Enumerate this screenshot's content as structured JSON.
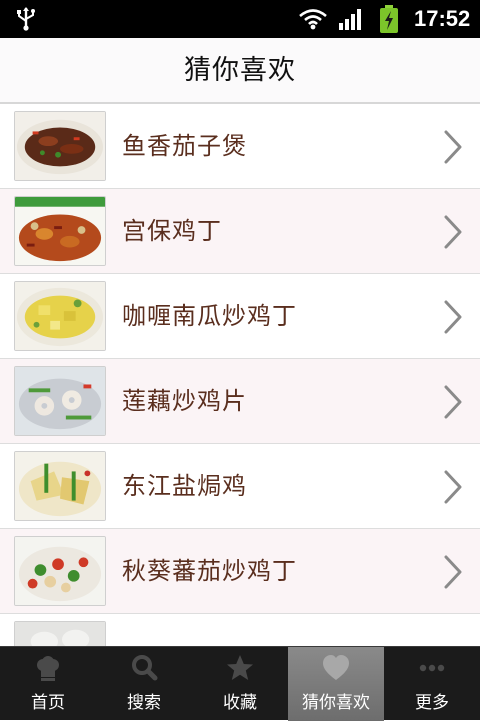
{
  "status_bar": {
    "time": "17:52",
    "icons": [
      "usb-icon",
      "wifi-icon",
      "signal-icon",
      "battery-charging-icon"
    ]
  },
  "header": {
    "title": "猜你喜欢"
  },
  "dishes": [
    {
      "name": "鱼香茄子煲"
    },
    {
      "name": "宫保鸡丁"
    },
    {
      "name": "咖喱南瓜炒鸡丁"
    },
    {
      "name": "莲藕炒鸡片"
    },
    {
      "name": "东江盐焗鸡"
    },
    {
      "name": "秋葵蕃茄炒鸡丁"
    },
    {
      "name": ""
    }
  ],
  "tabs": [
    {
      "label": "首页",
      "icon": "chef-hat-icon",
      "active": false
    },
    {
      "label": "搜索",
      "icon": "search-icon",
      "active": false
    },
    {
      "label": "收藏",
      "icon": "star-icon",
      "active": false
    },
    {
      "label": "猜你喜欢",
      "icon": "heart-icon",
      "active": true
    },
    {
      "label": "更多",
      "icon": "more-dots-icon",
      "active": false
    }
  ],
  "colors": {
    "title_bar": "#fbfafb",
    "row_alt": "#fbf4f6",
    "dish_text": "#5a2e1e",
    "tab_bar": "#1b1b1b",
    "tab_active": "#7b7b7b"
  }
}
